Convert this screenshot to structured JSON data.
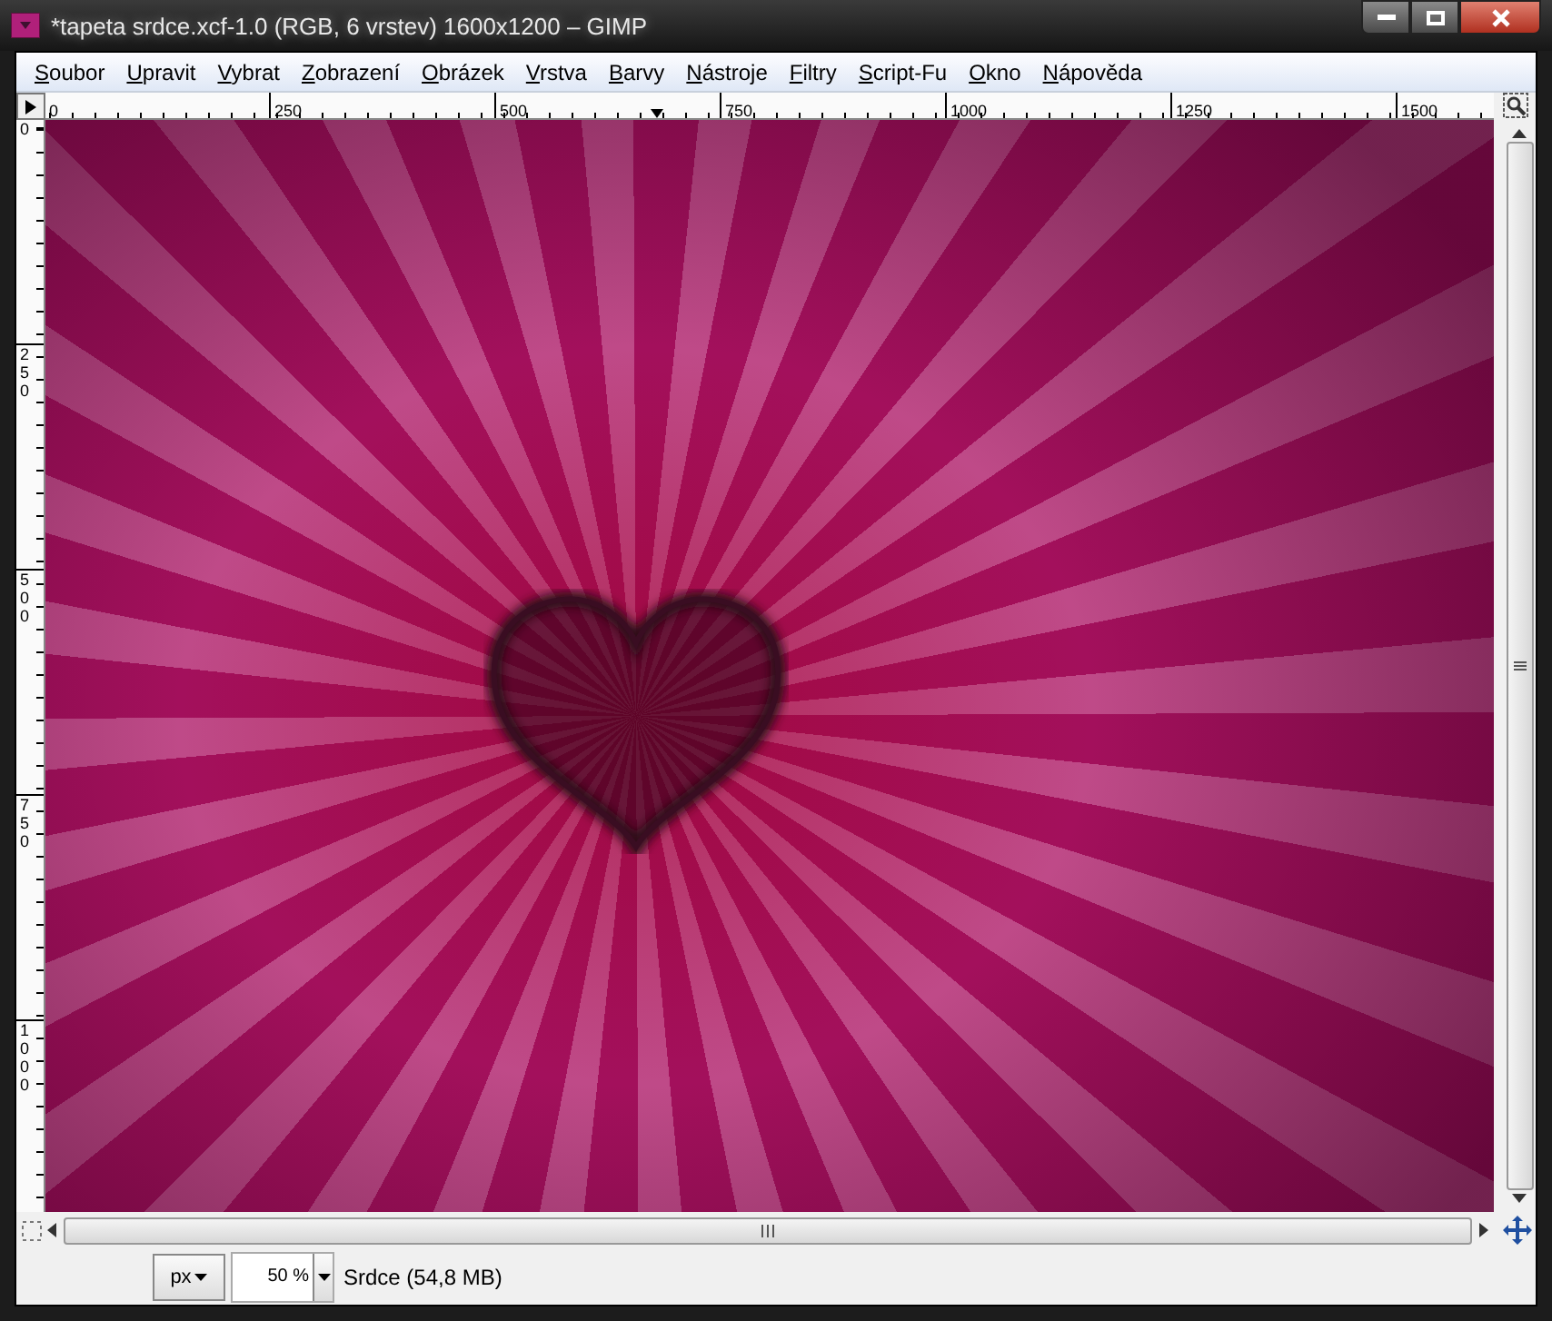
{
  "window": {
    "title": "*tapeta srdce.xcf-1.0 (RGB, 6 vrstev) 1600x1200 – GIMP"
  },
  "menu": [
    "Soubor",
    "Upravit",
    "Vybrat",
    "Zobrazení",
    "Obrázek",
    "Vrstva",
    "Barvy",
    "Nástroje",
    "Filtry",
    "Script-Fu",
    "Okno",
    "Nápověda"
  ],
  "horizontal_ruler": {
    "ticks": [
      "0",
      "250",
      "500",
      "750",
      "1000",
      "1250",
      "1500"
    ]
  },
  "vertical_ruler": {
    "ticks": [
      "0",
      "250",
      "500",
      "750",
      "1000"
    ]
  },
  "status_bar": {
    "unit": "px",
    "zoom": "50 %",
    "info": "Srdce (54,8 MB)"
  }
}
